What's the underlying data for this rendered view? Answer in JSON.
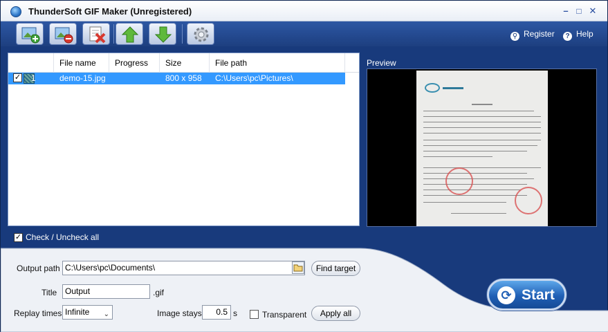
{
  "window": {
    "title": "ThunderSoft GIF Maker (Unregistered)"
  },
  "toolbar": {
    "buttons": [
      {
        "icon": "add-image-icon"
      },
      {
        "icon": "remove-image-icon"
      },
      {
        "icon": "clear-list-icon"
      },
      {
        "icon": "move-up-icon"
      },
      {
        "icon": "move-down-icon"
      },
      {
        "icon": "settings-icon"
      }
    ],
    "register_label": "Register",
    "help_label": "Help"
  },
  "file_list": {
    "columns": [
      "File name",
      "Progress",
      "Size",
      "File path"
    ],
    "rows": [
      {
        "index": "1",
        "checked": true,
        "file_name": "demo-15.jpg",
        "progress": "",
        "size": "800 x 958",
        "file_path": "C:\\Users\\pc\\Pictures\\"
      }
    ]
  },
  "check_all_label": "Check / Uncheck all",
  "preview_label": "Preview",
  "output": {
    "path_label": "Output path",
    "path_value": "C:\\Users\\pc\\Documents\\",
    "find_target_label": "Find target",
    "title_label": "Title",
    "title_value": "Output",
    "extension": ".gif",
    "replay_label": "Replay times",
    "replay_value": "Infinite",
    "image_stays_label": "Image stays",
    "image_stays_value": "0.5",
    "seconds_unit": "s",
    "transparent_label": "Transparent",
    "transparent_checked": false,
    "apply_all_label": "Apply all",
    "start_label": "Start"
  },
  "colors": {
    "accent": "#1d3f80",
    "selection": "#3399ff"
  }
}
